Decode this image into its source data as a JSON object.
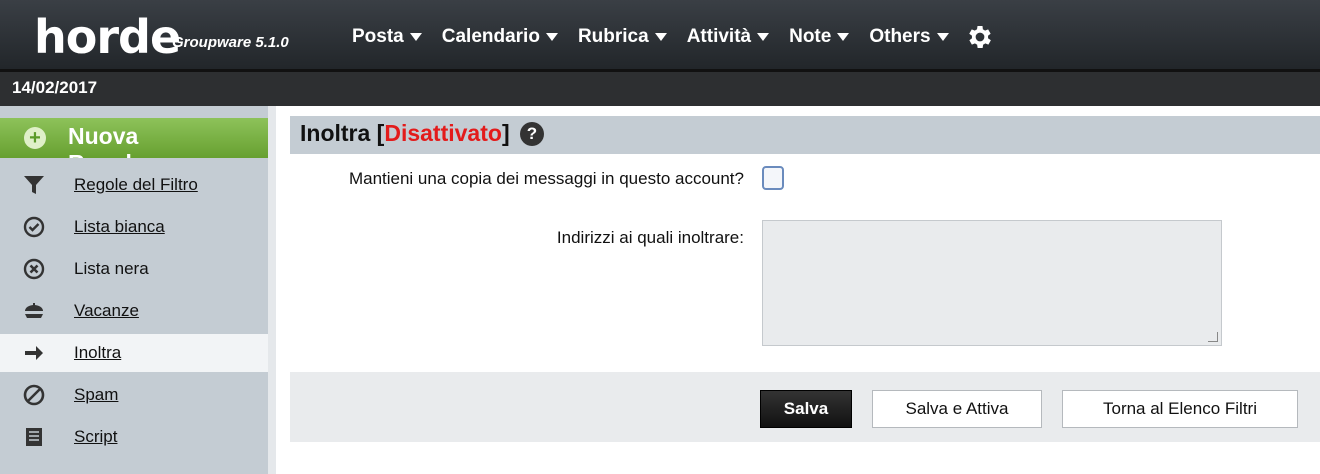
{
  "header": {
    "logo": "horde",
    "version": "Groupware 5.1.0",
    "menu": [
      {
        "label": "Posta"
      },
      {
        "label": "Calendario"
      },
      {
        "label": "Rubrica"
      },
      {
        "label": "Attività"
      },
      {
        "label": "Note"
      },
      {
        "label": "Others"
      }
    ]
  },
  "datebar": {
    "date": "14/02/2017"
  },
  "sidebar": {
    "new_rule_line1": "Nuova",
    "new_rule_line2": "Regola",
    "items": [
      {
        "label": "Regole del Filtro",
        "icon": "filter-icon"
      },
      {
        "label": "Lista bianca",
        "icon": "check-circle-icon"
      },
      {
        "label": "Lista nera",
        "icon": "x-circle-icon"
      },
      {
        "label": "Vacanze",
        "icon": "vacation-icon"
      },
      {
        "label": "Inoltra",
        "icon": "arrow-right-icon",
        "active": true
      },
      {
        "label": "Spam",
        "icon": "prohibited-icon"
      },
      {
        "label": "Script",
        "icon": "script-icon"
      }
    ]
  },
  "main": {
    "title": "Inoltra [",
    "status": "Disattivato",
    "title_end": "]",
    "keep_copy_label": "Mantieni una copia dei messaggi in questo account?",
    "addresses_label": "Indirizzi ai quali inoltrare:",
    "addresses_value": "",
    "keep_copy_checked": false,
    "buttons": {
      "save": "Salva",
      "save_activate": "Salva e Attiva",
      "back": "Torna al Elenco Filtri"
    }
  },
  "colors": {
    "accent_green": "#7ab547",
    "status_red": "#e31b1b",
    "header_dark": "#2d2f31"
  }
}
